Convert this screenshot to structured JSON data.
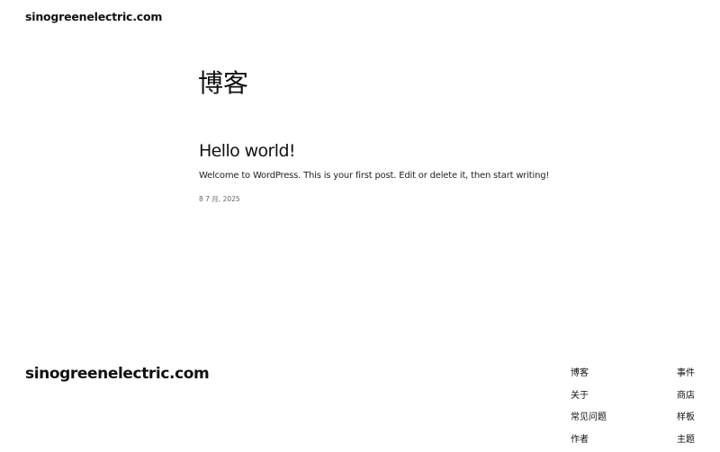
{
  "header": {
    "site_title": "sinogreenelectric.com"
  },
  "main": {
    "heading": "博客",
    "posts": [
      {
        "title": "Hello world!",
        "excerpt": "Welcome to WordPress. This is your first post. Edit or delete it, then start writing!",
        "date": "8 7 月, 2025"
      }
    ]
  },
  "footer": {
    "site_title": "sinogreenelectric.com",
    "nav_col_1": [
      "博客",
      "关于",
      "常见问题",
      "作者"
    ],
    "nav_col_2": [
      "事件",
      "商店",
      "样板",
      "主题"
    ]
  }
}
